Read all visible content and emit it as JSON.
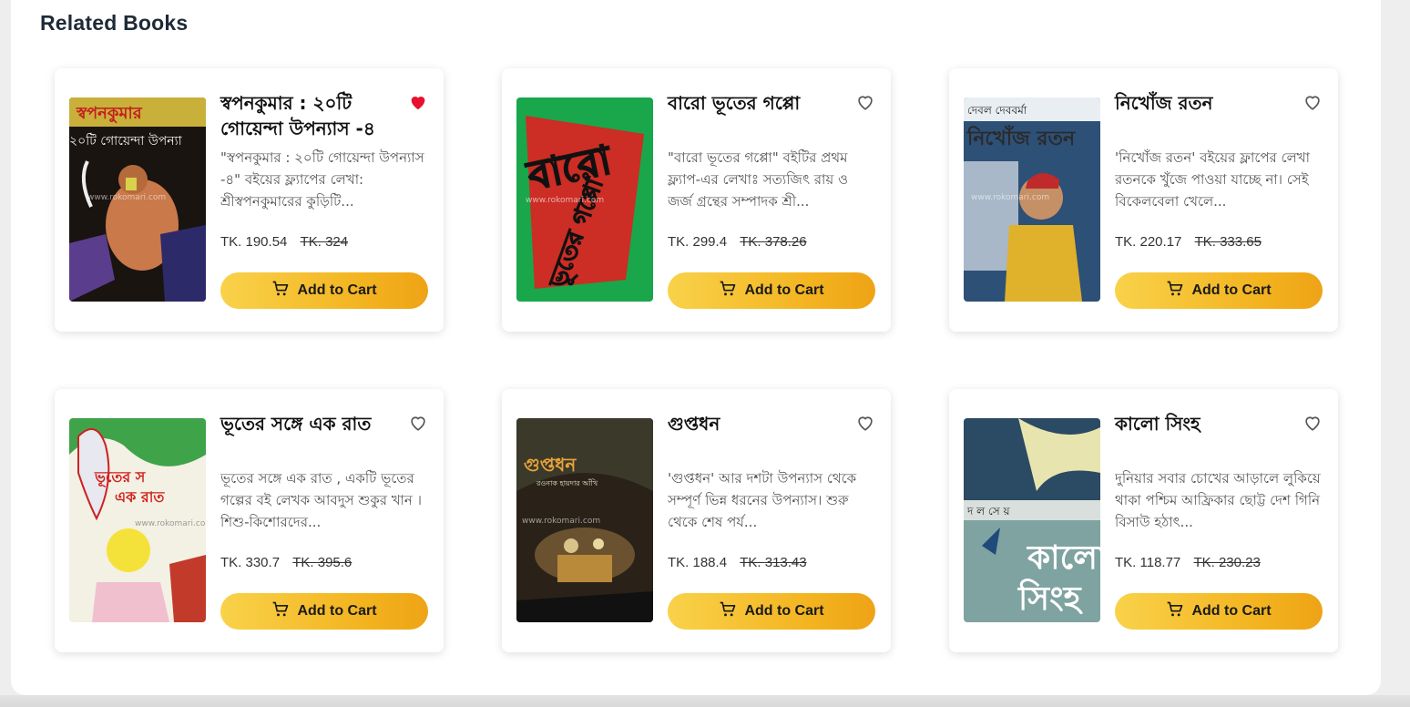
{
  "section": {
    "title": "Related Books"
  },
  "colors": {
    "heart_active": "#e8112d",
    "heart_outline": "#555555",
    "button_gradient_start": "#f9d24a",
    "button_gradient_end": "#eea316"
  },
  "books": [
    {
      "title": "স্বপনকুমার : ২০টি গোয়েন্দা উপন্যাস -৪",
      "description": "\"স্বপনকুমার : ২০টি গোয়েন্দা উপন্যাস -৪\" বইয়ের ফ্ল্যাপের লেখা: শ্রীস্বপনকুমারের কুড়িটি...",
      "price": "TK. 190.54",
      "old_price": "TK. 324",
      "favorited": true,
      "button_label": "Add to Cart",
      "cover_text": "স্বপনকুমার",
      "cover_subtext": "২০টি গোয়েন্দা উপন্যা",
      "cover_watermark": "www.rokomari.com"
    },
    {
      "title": "বারো ভূতের গপ্পো",
      "description": "\"বারো ভূতের গপ্পো\" বইটির প্রথম ফ্ল্যাপ-এর লেখাঃ সত্যজিৎ রায় ও জর্জ গ্রন্থের সম্পাদক শ্রী...",
      "price": "TK. 299.4",
      "old_price": "TK. 378.26",
      "favorited": false,
      "button_label": "Add to Cart",
      "cover_text": "বারো",
      "cover_subtext": "ভূতের গপ্পো",
      "cover_watermark": "www.rokomari.com"
    },
    {
      "title": "নিখোঁজ রতন",
      "description": "'নিখোঁজ রতন' বইয়ের ফ্লাপের লেখা রতনকে খুঁজে পাওয়া যাচ্ছে না। সেই বিকেলবেলা খেলে...",
      "price": "TK. 220.17",
      "old_price": "TK. 333.65",
      "favorited": false,
      "button_label": "Add to Cart",
      "cover_text": "নিখোঁজ রতন",
      "cover_subtext": "দেবল দেববর্মা",
      "cover_watermark": "www.rokomari.com"
    },
    {
      "title": "ভূতের সঙ্গে এক রাত",
      "description": "ভূতের সঙ্গে এক রাত , একটি ভূতের গল্পের বই লেখক আবদুস শুকুর খান । শিশু-কিশোরদের...",
      "price": "TK. 330.7",
      "old_price": "TK. 395.6",
      "favorited": false,
      "button_label": "Add to Cart",
      "cover_text": "ভূতের স",
      "cover_subtext": "এক রাত",
      "cover_watermark": "www.rokomari.com"
    },
    {
      "title": "গুপ্তধন",
      "description": "'গুপ্তধন' আর দশটা উপন্যাস থেকে সম্পূর্ণ ভিন্ন ধরনের উপন্যাস। শুরু থেকে শেষ পর্য...",
      "price": "TK. 188.4",
      "old_price": "TK. 313.43",
      "favorited": false,
      "button_label": "Add to Cart",
      "cover_text": "গুপ্তধন",
      "cover_subtext": "রওনাক হায়দার আঁখি",
      "cover_watermark": "www.rokomari.com"
    },
    {
      "title": "কালো সিংহ",
      "description": "দুনিয়ার সবার চোখের আড়ালে লুকিয়ে থাকা পশ্চিম আফ্রিকার ছোট্ট দেশ গিনি বিসাউ হঠাৎ...",
      "price": "TK. 118.77",
      "old_price": "TK. 230.23",
      "favorited": false,
      "button_label": "Add to Cart",
      "cover_text": "কালো",
      "cover_subtext": "সিংহ",
      "cover_watermark": "দ ল সে য়"
    }
  ]
}
